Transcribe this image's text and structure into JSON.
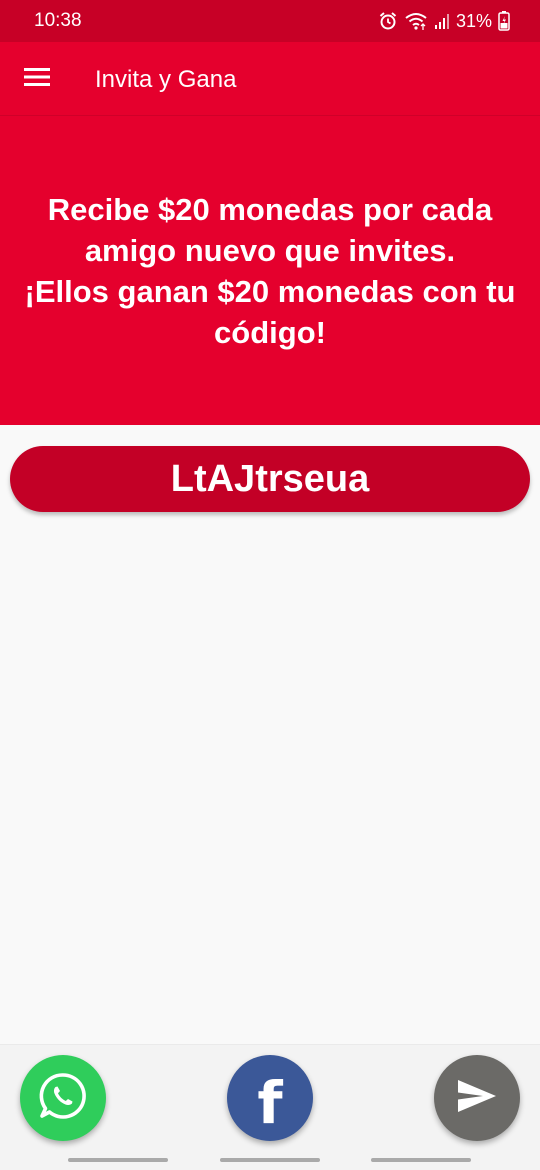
{
  "status_bar": {
    "time": "10:38",
    "battery_percent": "31%",
    "icons": [
      "alarm-icon",
      "wifi-icon",
      "signal-icon",
      "battery-icon"
    ]
  },
  "app_bar": {
    "title": "Invita y Gana",
    "menu_icon": "hamburger-menu-icon"
  },
  "banner": {
    "lines": [
      "Recibe $20 monedas por cada",
      "amigo nuevo que invites.",
      "¡Ellos ganan $20 monedas con tu",
      "código!"
    ]
  },
  "referral": {
    "code": "LtAJtrseua"
  },
  "share_buttons": [
    {
      "name": "whatsapp",
      "icon": "whatsapp-icon"
    },
    {
      "name": "facebook",
      "icon": "facebook-icon",
      "glyph": "f"
    },
    {
      "name": "send",
      "icon": "send-icon"
    }
  ],
  "colors": {
    "status_bar": "#c70026",
    "primary": "#e5002d",
    "code_pill": "#c30026",
    "whatsapp": "#2fcd5b",
    "facebook": "#3b5898",
    "send": "#6b6a67",
    "background": "#f9f9f9"
  }
}
